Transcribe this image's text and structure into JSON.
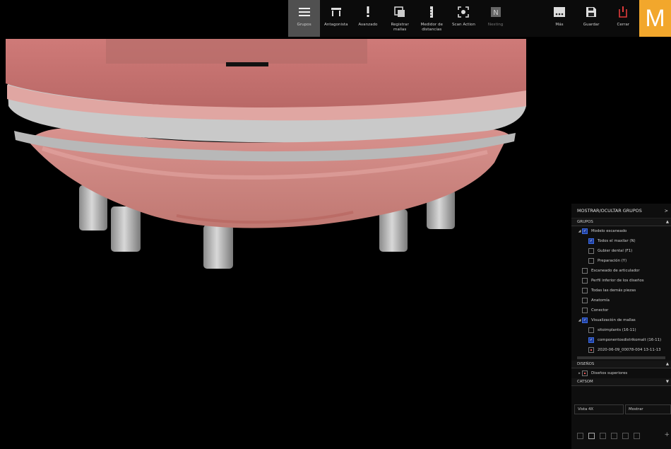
{
  "toolbar": {
    "buttons": [
      {
        "label": "Grupos",
        "icon": "menu-icon",
        "active": true
      },
      {
        "label": "Antagonista",
        "icon": "antagonist-icon"
      },
      {
        "label": "Avanzado",
        "icon": "exclamation-icon"
      },
      {
        "label": "Registrar mallas",
        "icon": "register-mesh-icon"
      },
      {
        "label": "Medidor de distancias",
        "icon": "distance-meter-icon"
      },
      {
        "label": "Scan Action",
        "icon": "scan-action-icon"
      },
      {
        "label": "Nesting",
        "icon": "nesting-icon",
        "disabled": true
      },
      {
        "label": "Más",
        "icon": "more-icon"
      },
      {
        "label": "Guardar",
        "icon": "save-icon"
      },
      {
        "label": "Cerrar",
        "icon": "power-icon"
      }
    ],
    "brand_letter": "M"
  },
  "panel": {
    "title": "MOSTRAR/OCULTAR GRUPOS",
    "title_glyph": ">",
    "sections": {
      "grupos": "GRUPOS",
      "diseños": "DISEÑOS",
      "catsom": "CATSOM"
    },
    "grupos_items": [
      {
        "label": "Modelo escaneado",
        "indent": 0,
        "twisty": "◢",
        "checked": true
      },
      {
        "label": "Todos el maxilar (N)",
        "indent": 1,
        "checked": true
      },
      {
        "label": "Gubier dental (F1)",
        "indent": 1
      },
      {
        "label": "Preparación (Y)",
        "indent": 1
      },
      {
        "label": "Escaneado de articulador",
        "indent": 0
      },
      {
        "label": "Perfil inferior de los diseños",
        "indent": 0
      },
      {
        "label": "Todas las demás piezas",
        "indent": 0
      },
      {
        "label": "Anatomía",
        "indent": 0
      },
      {
        "label": "Conector",
        "indent": 0
      },
      {
        "label": "Visualización de mallas",
        "indent": 0,
        "twisty": "◢",
        "checked": true
      },
      {
        "label": "sitoimplants (16-11)",
        "indent": 1
      },
      {
        "label": "componentosdistrikomalt (16-11)",
        "indent": 1,
        "checked": true
      },
      {
        "label": "2020-06-09_00078-004 13-11-13",
        "indent": 1,
        "dotted": true
      }
    ],
    "diseños_items": [
      {
        "label": "Diseños superiores",
        "indent": 0,
        "twisty": "▸",
        "dotted": true
      }
    ],
    "select_left": "Vista 4X",
    "select_right": "Mostrar",
    "plus_glyph": "+"
  }
}
